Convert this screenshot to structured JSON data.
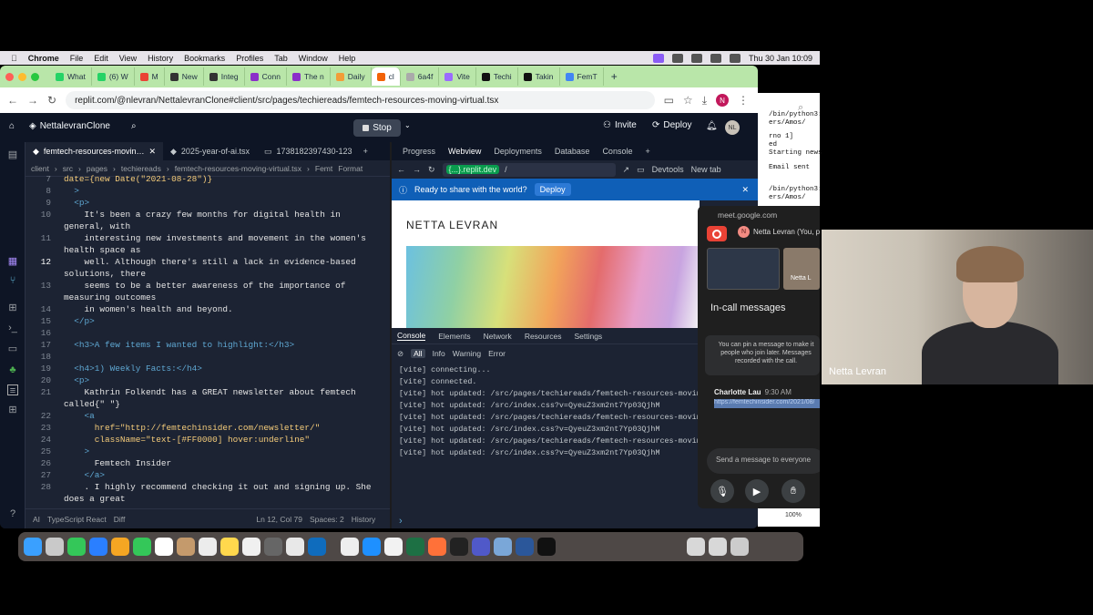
{
  "menubar": {
    "app": "Chrome",
    "items": [
      "File",
      "Edit",
      "View",
      "History",
      "Bookmarks",
      "Profiles",
      "Tab",
      "Window",
      "Help"
    ],
    "clock": "Thu 30 Jan  10:09"
  },
  "browser": {
    "tabs": [
      "What",
      "(6) W",
      "M",
      "New",
      "Integ",
      "Conn",
      "The n",
      "Daily",
      "cl",
      "6a4f",
      "Vite",
      "Techi",
      "Takin",
      "FemT"
    ],
    "url": "replit.com/@nlevran/NettalevranClone#client/src/pages/techiereads/femtech-resources-moving-virtual.tsx",
    "profile_initial": "N"
  },
  "replit": {
    "project": "NettalevranClone",
    "stop": "Stop",
    "invite": "Invite",
    "deploy": "Deploy",
    "avatar": "NL",
    "editor_tabs": [
      "femtech-resources-movin…",
      "2025-year-of-ai.tsx",
      "1738182397430-123"
    ],
    "breadcrumbs": [
      "client",
      "src",
      "pages",
      "techiereads",
      "femtech-resources-moving-virtual.tsx",
      "Femt",
      "Format"
    ],
    "code": [
      {
        "n": "7",
        "t": "date={new Date(\"2021-08-28\")}"
      },
      {
        "n": "8",
        "t": "  >"
      },
      {
        "n": "9",
        "t": "  <p>"
      },
      {
        "n": "10",
        "t": "    It's been a crazy few months for digital health in"
      },
      {
        "n": "",
        "t": "general, with"
      },
      {
        "n": "11",
        "t": "    interesting new investments and movement in the women's"
      },
      {
        "n": "",
        "t": "health space as"
      },
      {
        "n": "12",
        "t": "    well. Although there's still a lack in evidence-based"
      },
      {
        "n": "",
        "t": "solutions, there"
      },
      {
        "n": "13",
        "t": "    seems to be a better awareness of the importance of"
      },
      {
        "n": "",
        "t": "measuring outcomes"
      },
      {
        "n": "14",
        "t": "    in women's health and beyond."
      },
      {
        "n": "15",
        "t": "  </p>"
      },
      {
        "n": "16",
        "t": ""
      },
      {
        "n": "17",
        "t": "  <h3>A few items I wanted to highlight:</h3>"
      },
      {
        "n": "18",
        "t": ""
      },
      {
        "n": "19",
        "t": "  <h4>1) Weekly Facts:</h4>"
      },
      {
        "n": "20",
        "t": "  <p>"
      },
      {
        "n": "21",
        "t": "    Kathrin Folkendt has a GREAT newsletter about femtech"
      },
      {
        "n": "",
        "t": "called{\" \"}"
      },
      {
        "n": "22",
        "t": "    <a"
      },
      {
        "n": "23",
        "t": "      href=\"http://femtechinsider.com/newsletter/\""
      },
      {
        "n": "24",
        "t": "      className=\"text-[#FF0000] hover:underline\""
      },
      {
        "n": "25",
        "t": "    >"
      },
      {
        "n": "26",
        "t": "      Femtech Insider"
      },
      {
        "n": "27",
        "t": "    </a>"
      },
      {
        "n": "28",
        "t": "    . I highly recommend checking it out and signing up. She"
      },
      {
        "n": "",
        "t": "does a great"
      }
    ],
    "status": {
      "ai": "AI",
      "lang": "TypeScript React",
      "diff": "Diff",
      "pos": "Ln 12, Col 79",
      "spaces": "Spaces: 2",
      "history": "History"
    },
    "right_tabs": [
      "Progress",
      "Webview",
      "Deployments",
      "Database",
      "Console"
    ],
    "webview_url": "{...}.replit.dev",
    "webview_path": "/",
    "devtools": "Devtools",
    "newtab": "New tab",
    "share_text": "Ready to share with the world?",
    "share_deploy": "Deploy",
    "site_brand": "NETTA LEVRAN",
    "devtool_tabs": [
      "Console",
      "Elements",
      "Network",
      "Resources",
      "Settings"
    ],
    "levels": [
      "All",
      "Info",
      "Warning",
      "Error"
    ],
    "logs": [
      "[vite] connecting...",
      "[vite] connected.",
      "[vite] hot updated: /src/pages/techiereads/femtech-resources-moving-virtu",
      "[vite] hot updated: /src/index.css?v=QyeuZ3xm2nt7Yp03QjhM",
      "[vite] hot updated: /src/pages/techiereads/femtech-resources-moving-virtu",
      "[vite] hot updated: /src/index.css?v=QyeuZ3xm2nt7Yp03QjhM",
      "[vite] hot updated: /src/pages/techiereads/femtech-resources-moving-virtu",
      "[vite] hot updated: /src/index.css?v=QyeuZ3xm2nt7Yp03QjhM"
    ]
  },
  "meet": {
    "url": "meet.google.com",
    "self": "Netta Levran (You, pr",
    "self_initial": "N",
    "header": "In-call messages",
    "pin_note": "You can pin a message to make it people who join later. Messages recorded with the call.",
    "sender": "Charlotte Lau",
    "time": "9:30 AM",
    "link": "https://femtechinsider.com/2021/08/",
    "send_placeholder": "Send a message to everyone",
    "thumb_name": "Netta L"
  },
  "terminal": {
    "lines": [
      "/bin/python3:",
      "ers/Amos/",
      "rno 1]",
      "ed",
      "Starting news",
      "Email sent",
      "/bin/python3:",
      "ers/Amos/"
    ],
    "zoom": "100%"
  },
  "webcam": {
    "name": "Netta Levran"
  }
}
